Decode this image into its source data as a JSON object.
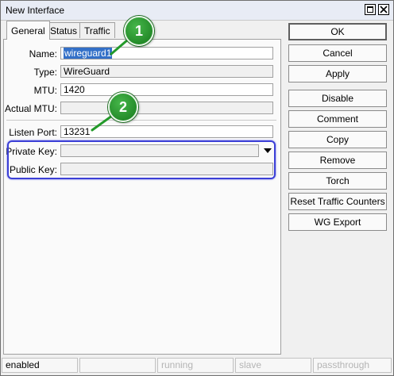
{
  "window": {
    "title": "New Interface"
  },
  "tabs": [
    {
      "label": "General",
      "active": true
    },
    {
      "label": "Status",
      "active": false
    },
    {
      "label": "Traffic",
      "active": false
    }
  ],
  "form": {
    "name": {
      "label": "Name:",
      "value": "wireguard1"
    },
    "type": {
      "label": "Type:",
      "value": "WireGuard"
    },
    "mtu": {
      "label": "MTU:",
      "value": "1420"
    },
    "actual_mtu": {
      "label": "Actual MTU:",
      "value": ""
    },
    "listen_port": {
      "label": "Listen Port:",
      "value": "13231"
    },
    "private_key": {
      "label": "Private Key:",
      "value": ""
    },
    "public_key": {
      "label": "Public Key:",
      "value": ""
    }
  },
  "callouts": {
    "one": "1",
    "two": "2"
  },
  "buttons": {
    "ok": "OK",
    "cancel": "Cancel",
    "apply": "Apply",
    "disable": "Disable",
    "comment": "Comment",
    "copy": "Copy",
    "remove": "Remove",
    "torch": "Torch",
    "reset": "Reset Traffic Counters",
    "wg_export": "WG Export"
  },
  "status": {
    "state": "enabled",
    "blank": "",
    "running": "running",
    "slave": "slave",
    "passthrough": "passthrough"
  },
  "colors": {
    "highlight": "#3b3fd6",
    "callout": "#2e9a34",
    "selection": "#3370c8"
  }
}
